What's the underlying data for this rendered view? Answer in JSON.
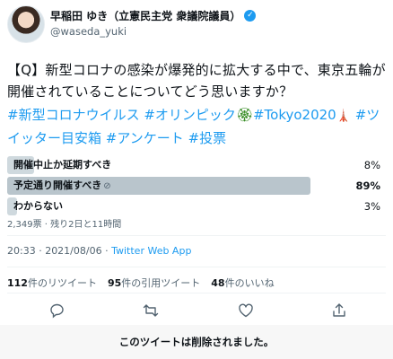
{
  "author": {
    "display_name": "早稲田 ゆき（立憲民主党 衆議院議員）",
    "handle": "@waseda_yuki",
    "verified_glyph": "✓"
  },
  "tweet": {
    "text": "【Q】新型コロナの感染が爆発的に拡大する中で、東京五輪が開催されていることについてどう思いますか？",
    "hashtags": {
      "h1": "#新型コロナウイルス",
      "h2": "#オリンピック",
      "wreath": "🏵",
      "h3": "#Tokyo2020",
      "tower": "🗼",
      "h4": "#ツイッター目安箱",
      "h5": "#アンケート",
      "h6": "#投票"
    }
  },
  "poll": {
    "options": [
      {
        "label": "開催中止か延期すべき",
        "percent_text": "8%",
        "percent": 8
      },
      {
        "label": "予定通り開催すべき",
        "percent_text": "89%",
        "percent": 89,
        "checked_glyph": "⊘"
      },
      {
        "label": "わからない",
        "percent_text": "3%",
        "percent": 3
      }
    ],
    "meta": "2,349票 · 残り2日と11時間"
  },
  "timestamp": {
    "time": "20:33 · 2021/08/06 · ",
    "source": "Twitter Web App"
  },
  "stats": {
    "retweets_count": "112",
    "retweets_label": "件のリツイート",
    "quotes_count": "95",
    "quotes_label": "件の引用ツイート",
    "likes_count": "48",
    "likes_label": "件のいいね"
  },
  "actions": [
    "reply-icon",
    "retweet-icon",
    "like-icon",
    "share-icon"
  ],
  "banner": {
    "text": "このツイートは削除されました。"
  },
  "colors": {
    "accent": "#1d9bf0",
    "bar": "#cfd9de",
    "bar_top": "#b9c5cc",
    "muted": "#536471"
  }
}
